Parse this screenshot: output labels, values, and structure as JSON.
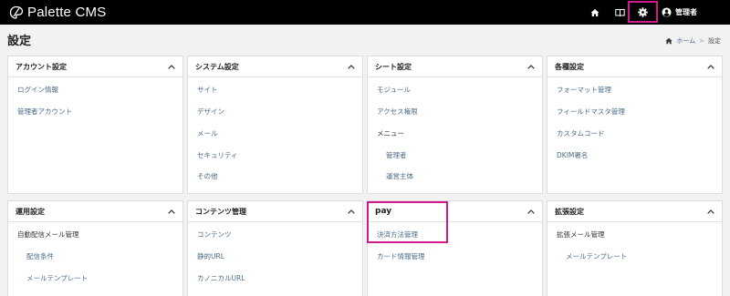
{
  "header": {
    "brand": "Palette CMS",
    "user_name": "管理者",
    "icons": [
      "home-icon",
      "book-icon",
      "gear-icon",
      "user-icon"
    ]
  },
  "page": {
    "title": "設定",
    "breadcrumb": [
      "ホーム",
      "設定"
    ]
  },
  "cards": {
    "account": {
      "title": "アカウント設定",
      "items": [
        "ログイン情報",
        "管理者アカウント"
      ]
    },
    "system": {
      "title": "システム設定",
      "items": [
        "サイト",
        "デザイン",
        "メール",
        "セキュリティ",
        "その他"
      ]
    },
    "sheet": {
      "title": "シート設定",
      "items": [
        "モジュール",
        "アクセス権限",
        "メニュー",
        "管理者",
        "運営主体"
      ]
    },
    "various": {
      "title": "各種設定",
      "items": [
        "フォーマット管理",
        "フィールドマスタ管理",
        "カスタムコード",
        "DKIM署名"
      ]
    },
    "operation": {
      "title": "運用設定",
      "items": [
        "自動配信メール管理",
        "配信条件",
        "メールテンプレート"
      ]
    },
    "contents": {
      "title": "コンテンツ管理",
      "items": [
        "コンテンツ",
        "静的URL",
        "カノニカルURL"
      ]
    },
    "pay": {
      "title": "pay",
      "items": [
        "決済方法管理",
        "カード情報管理"
      ]
    },
    "extension": {
      "title": "拡張設定",
      "items": [
        "拡張メール管理",
        "メールテンプレート"
      ]
    }
  },
  "colors": {
    "highlight": "#d11b8c",
    "link": "#4a6a8a",
    "topbar": "#000000"
  }
}
